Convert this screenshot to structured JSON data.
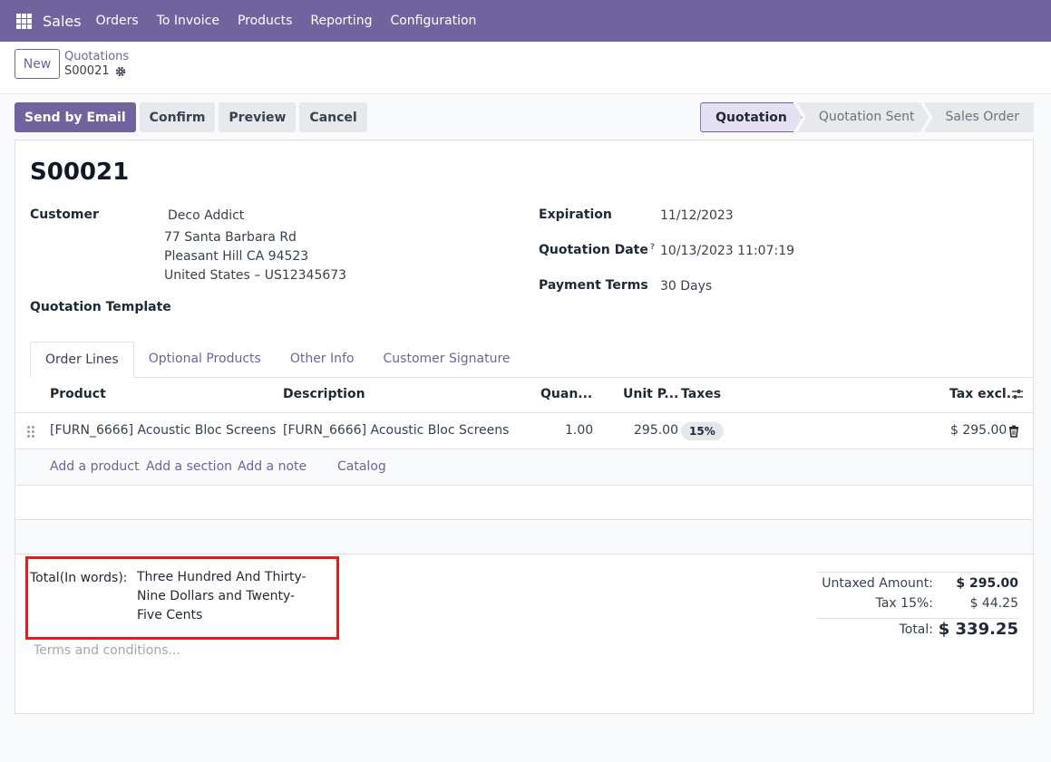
{
  "navbar": {
    "brand": "Sales",
    "items": [
      "Orders",
      "To Invoice",
      "Products",
      "Reporting",
      "Configuration"
    ]
  },
  "control_panel": {
    "new_label": "New",
    "breadcrumb_parent": "Quotations",
    "breadcrumb_current": "S00021"
  },
  "actions": {
    "send_email": "Send by Email",
    "confirm": "Confirm",
    "preview": "Preview",
    "cancel": "Cancel"
  },
  "status": {
    "stages": [
      "Quotation",
      "Quotation Sent",
      "Sales Order"
    ],
    "active": "Quotation"
  },
  "form": {
    "name": "S00021",
    "customer_label": "Customer",
    "customer_name": "Deco Addict",
    "address_line1": "77 Santa Barbara Rd",
    "address_line2": "Pleasant Hill CA 94523",
    "address_line3": "United States – US12345673",
    "template_label": "Quotation Template",
    "expiration_label": "Expiration",
    "expiration_value": "11/12/2023",
    "quotation_date_label": "Quotation Date",
    "quotation_date_help": "?",
    "quotation_date_value": "10/13/2023 11:07:19",
    "payment_terms_label": "Payment Terms",
    "payment_terms_value": "30 Days"
  },
  "tabs": [
    "Order Lines",
    "Optional Products",
    "Other Info",
    "Customer Signature"
  ],
  "order_lines": {
    "headers": {
      "product": "Product",
      "description": "Description",
      "quantity": "Quan...",
      "unit_price": "Unit P...",
      "taxes": "Taxes",
      "tax_excl": "Tax excl."
    },
    "rows": [
      {
        "product": "[FURN_6666] Acoustic Bloc Screens",
        "description": "[FURN_6666] Acoustic Bloc Screens",
        "quantity": "1.00",
        "unit_price": "295.00",
        "tax": "15%",
        "subtotal": "$ 295.00"
      }
    ],
    "add_product": "Add a product",
    "add_section": "Add a section",
    "add_note": "Add a note",
    "catalog": "Catalog"
  },
  "footer": {
    "words_label": "Total(In words):",
    "words_value": "Three Hundred And Thirty-Nine Dollars and Twenty-Five Cents",
    "terms_placeholder": "Terms and conditions..."
  },
  "totals": {
    "untaxed_label": "Untaxed Amount:",
    "untaxed_value": "$ 295.00",
    "tax_label": "Tax 15%:",
    "tax_value": "$ 44.25",
    "total_label": "Total:",
    "total_value": "$ 339.25"
  },
  "colors": {
    "brand": "#71639e",
    "highlight_box": "#e11d1d"
  }
}
